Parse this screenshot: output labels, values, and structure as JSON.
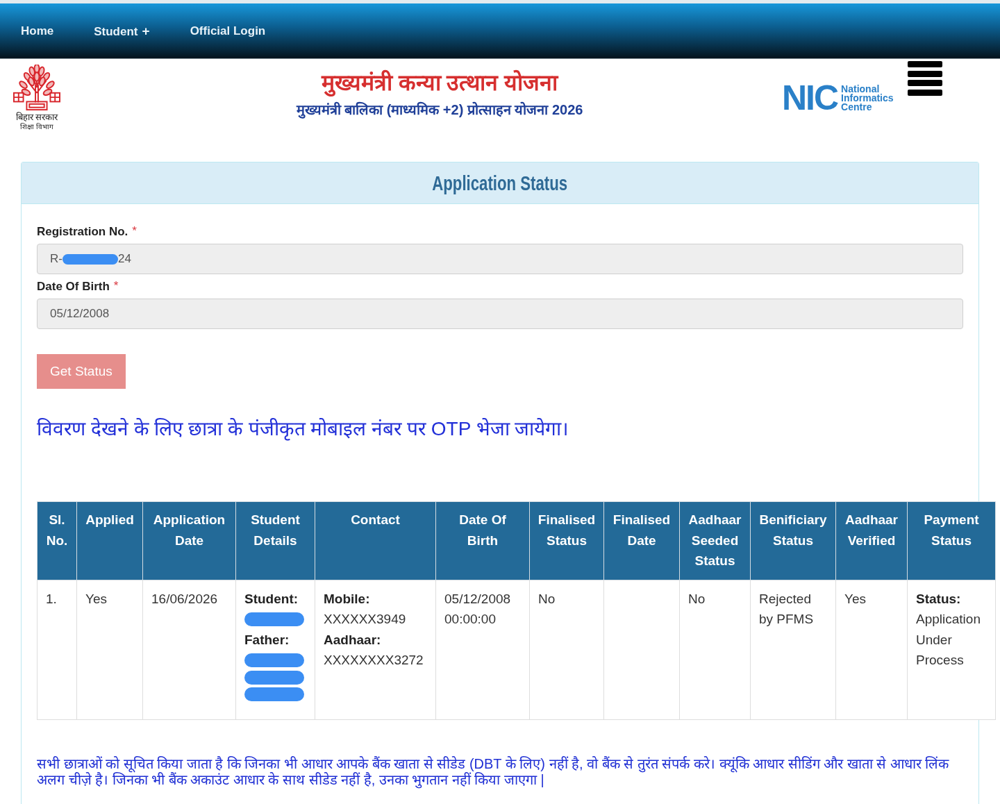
{
  "nav": {
    "items": [
      {
        "label": "Home"
      },
      {
        "label": "Student",
        "toggle": "+"
      },
      {
        "label": "Official Login"
      }
    ]
  },
  "header": {
    "emblem": {
      "caption": "बिहार सरकार",
      "subcaption": "शिक्षा विभाग"
    },
    "title": "मुख्यमंत्री कन्या उत्थान योजना",
    "subtitle": "मुख्यमंत्री बालिका (माध्यमिक +2) प्रोत्साहन योजना 2026",
    "partner_logo": {
      "wordmark": "NIC",
      "caption_lines": [
        "National",
        "Informatics",
        "Centre"
      ]
    }
  },
  "panel": {
    "title": "Application Status",
    "fields": [
      {
        "label": "Registration No.",
        "required_mark": "*",
        "value": [
          {
            "kind": "text",
            "text": "R-"
          },
          {
            "kind": "redacted"
          },
          {
            "kind": "text",
            "text": "24"
          }
        ]
      },
      {
        "label": "Date Of Birth",
        "required_mark": "*",
        "value": [
          {
            "kind": "text",
            "text": "05/12/2008"
          }
        ]
      }
    ],
    "button": {
      "label": "Get Status",
      "disabled": true
    },
    "otp_notice": "विवरण देखने के लिए छात्रा के पंजीकृत मोबाइल नंबर पर OTP भेजा जायेगा।",
    "table": {
      "columns": [
        "Sl. No.",
        "Applied",
        "Application Date",
        "Student Details",
        "Contact",
        "Date Of Birth",
        "Finalised Status",
        "Finalised Date",
        "Aadhaar Seeded Status",
        "Benificiary Status",
        "Aadhaar Verified",
        "Payment Status"
      ],
      "rows": [
        {
          "cells": [
            {
              "lines": [
                {
                  "kind": "text",
                  "text": "1."
                }
              ]
            },
            {
              "lines": [
                {
                  "kind": "text",
                  "text": "Yes"
                }
              ]
            },
            {
              "lines": [
                {
                  "kind": "text",
                  "text": "16/06/2026"
                }
              ]
            },
            {
              "lines": [
                {
                  "kind": "label",
                  "text": "Student:"
                },
                {
                  "kind": "redacted"
                },
                {
                  "kind": "label",
                  "text": "Father:"
                },
                {
                  "kind": "redacted"
                },
                {
                  "kind": "redacted"
                },
                {
                  "kind": "redacted"
                }
              ]
            },
            {
              "lines": [
                {
                  "kind": "label",
                  "text": "Mobile:"
                },
                {
                  "kind": "text",
                  "text": "XXXXXX3949"
                },
                {
                  "kind": "label",
                  "text": "Aadhaar:"
                },
                {
                  "kind": "text",
                  "text": "XXXXXXXX3272"
                }
              ]
            },
            {
              "lines": [
                {
                  "kind": "text",
                  "text": "05/12/2008 00:00:00"
                }
              ]
            },
            {
              "lines": [
                {
                  "kind": "text",
                  "text": "No"
                }
              ]
            },
            {},
            {
              "lines": [
                {
                  "kind": "text",
                  "text": "No"
                }
              ]
            },
            {
              "lines": [
                {
                  "kind": "text",
                  "text": "Rejected by PFMS"
                }
              ]
            },
            {
              "lines": [
                {
                  "kind": "text",
                  "text": "Yes"
                }
              ]
            },
            {
              "lines": [
                {
                  "kind": "label",
                  "text": "Status:"
                },
                {
                  "kind": "text",
                  "text": "Application Under Process"
                }
              ]
            }
          ]
        }
      ]
    },
    "seeding_notice": "सभी छात्राओं को सूचित किया जाता है कि जिनका भी आधार आपके बैंक खाता से सीडेड (DBT के लिए) नहीं है, वो बैंक से तुरंत संपर्क करे। क्यूंकि आधार सीडिंग और खाता से आधार लिंक अलग चीज़े है। जिनका भी बैंक अकाउंट आधार के साथ सीडेड नहीं है, उनका भुगतान नहीं किया जाएगा |"
  }
}
